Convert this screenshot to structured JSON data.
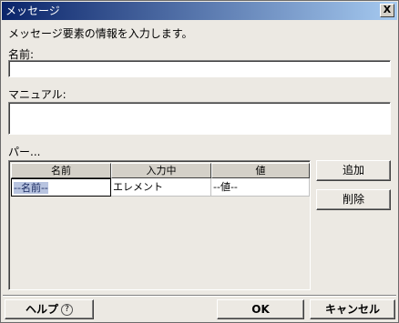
{
  "window": {
    "title": "メッセージ",
    "close_label": "X"
  },
  "description": "メッセージ要素の情報を入力します。",
  "name_field": {
    "label": "名前:",
    "value": ""
  },
  "manual_field": {
    "label": "マニュアル:",
    "value": ""
  },
  "params": {
    "label": "パー...",
    "columns": [
      "名前",
      "入力中",
      "値"
    ],
    "rows": [
      {
        "name": "--名前--",
        "input": "エレメント",
        "value": "--値--"
      }
    ]
  },
  "side_buttons": {
    "add": "追加",
    "delete": "削除"
  },
  "footer": {
    "help": "ヘルプ",
    "help_icon": "?",
    "ok": "OK",
    "cancel": "キャンセル"
  }
}
